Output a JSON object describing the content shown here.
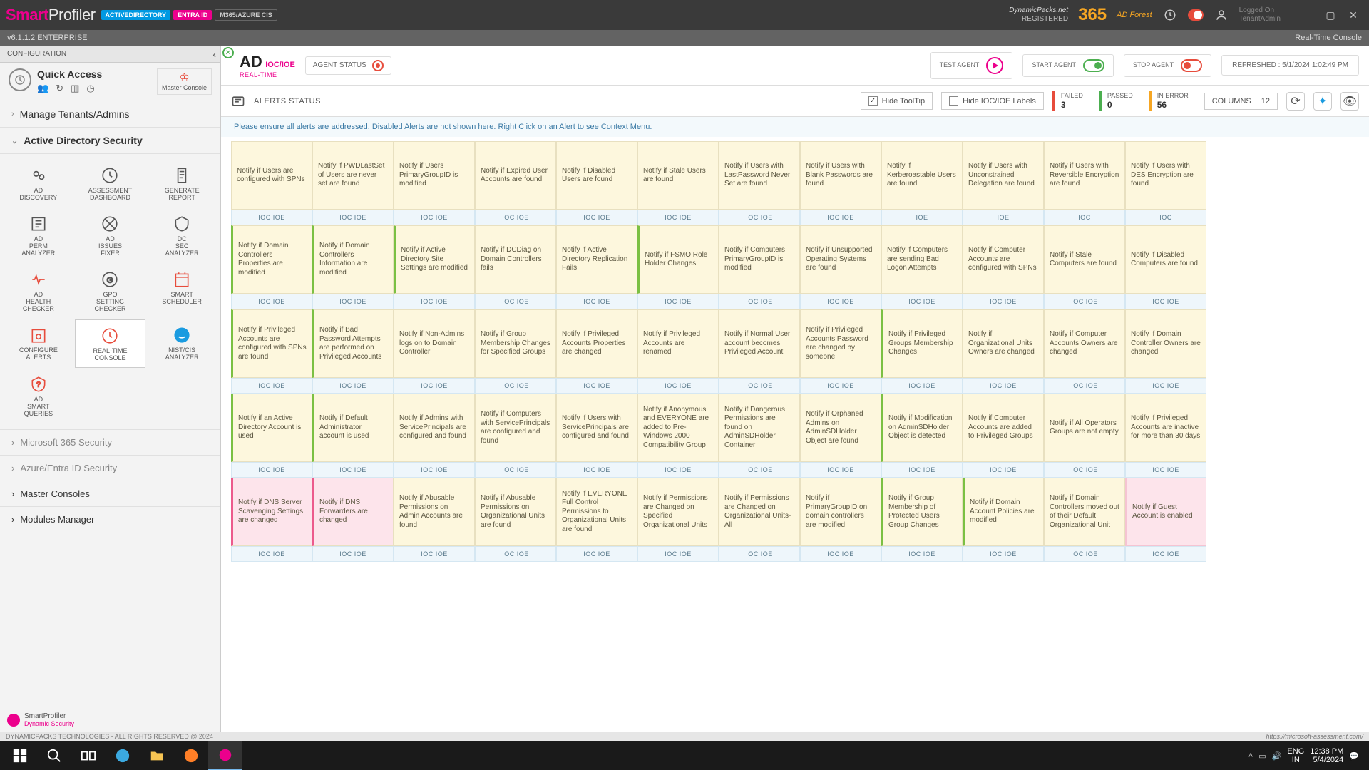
{
  "titlebar": {
    "logo_smart": "Smart",
    "logo_profiler": "Profiler",
    "badges": {
      "ad": "ACTIVEDIRECTORY",
      "entra": "ENTRA ID",
      "m365": "M365/AZURE CIS"
    },
    "reg_site": "DynamicPacks.net",
    "reg_status": "REGISTERED",
    "count365": "365",
    "adforest": "AD Forest",
    "logged_l1": "Logged On",
    "logged_l2": "TenantAdmin"
  },
  "verbar": {
    "left": "v6.1.1.2  ENTERPRISE",
    "right": "Real-Time Console"
  },
  "sidebar": {
    "config": "CONFIGURATION",
    "quick_access": "Quick Access",
    "master_console": "Master Console",
    "nav_tenants": "Manage Tenants/Admins",
    "nav_adsec": "Active Directory Security",
    "icons": [
      {
        "l": "AD DISCOVERY"
      },
      {
        "l": "ASSESSMENT DASHBOARD"
      },
      {
        "l": "GENERATE REPORT"
      },
      {
        "l": "AD PERM ANALYZER"
      },
      {
        "l": "AD ISSUES FIXER"
      },
      {
        "l": "DC SEC ANALYZER"
      },
      {
        "l": "AD HEALTH CHECKER"
      },
      {
        "l": "GPO SETTING CHECKER"
      },
      {
        "l": "SMART SCHEDULER"
      },
      {
        "l": "CONFIGURE ALERTS"
      },
      {
        "l": "REAL-TIME CONSOLE"
      },
      {
        "l": "NIST/CIS ANALYZER"
      },
      {
        "l": "AD SMART QUERIES"
      }
    ],
    "nav_m365": "Microsoft 365 Security",
    "nav_azure": "Azure/Entra ID Security",
    "nav_master": "Master Consoles",
    "nav_modules": "Modules Manager",
    "footer_l1": "SmartProfiler",
    "footer_l2": "Dynamic Security"
  },
  "header": {
    "ad": "AD",
    "ioc": "IOC/IOE",
    "rt": "REAL-TIME",
    "agent_status": "AGENT STATUS",
    "test": "TEST AGENT",
    "start": "START AGENT",
    "stop": "STOP AGENT",
    "refreshed": "REFRESHED : 5/1/2024 1:02:49 PM"
  },
  "alertsbar": {
    "title": "ALERTS STATUS",
    "hide_tooltip": "Hide ToolTip",
    "hide_labels": "Hide IOC/IOE Labels",
    "failed_l": "FAILED",
    "failed_v": "3",
    "passed_l": "PASSED",
    "passed_v": "0",
    "error_l": "IN ERROR",
    "error_v": "56",
    "columns_l": "COLUMNS",
    "columns_v": "12"
  },
  "note": "Please ensure all alerts are addressed. Disabled Alerts are not shown here. Right Click on an Alert to see Context Menu.",
  "tag_iocioe": "IOC IOE",
  "tag_ioe": "IOE",
  "tag_ioc": "IOC",
  "rows": [
    {
      "cards": [
        {
          "t": "Notify if Users are configured with SPNs"
        },
        {
          "t": "Notify if PWDLastSet of Users are never set are found"
        },
        {
          "t": "Notify if Users PrimaryGroupID is modified"
        },
        {
          "t": "Notify if Expired User Accounts are found"
        },
        {
          "t": "Notify if Disabled Users are found"
        },
        {
          "t": "Notify if Stale Users are found"
        },
        {
          "t": "Notify if Users with LastPassword Never Set are found"
        },
        {
          "t": "Notify if Users with Blank Passwords are found"
        },
        {
          "t": "Notify if Kerberoastable Users are found"
        },
        {
          "t": "Notify if Users with Unconstrained Delegation are found"
        },
        {
          "t": "Notify if Users with Reversible Encryption are found"
        },
        {
          "t": "Notify if Users with DES Encryption are found"
        }
      ],
      "tags": [
        "IOC IOE",
        "IOC IOE",
        "IOC IOE",
        "IOC IOE",
        "IOC IOE",
        "IOC IOE",
        "IOC IOE",
        "IOC IOE",
        "IOE",
        "IOE",
        "IOC",
        "IOC"
      ]
    },
    {
      "cards": [
        {
          "t": "Notify if Domain Controllers Properties are modified",
          "g": 1
        },
        {
          "t": "Notify if Domain Controllers Information are modified",
          "g": 1
        },
        {
          "t": "Notify if Active Directory Site Settings are modified",
          "g": 1
        },
        {
          "t": "Notify if DCDiag on Domain Controllers fails"
        },
        {
          "t": "Notify if Active Directory Replication Fails"
        },
        {
          "t": "Notify if FSMO Role Holder Changes",
          "g": 1
        },
        {
          "t": "Notify if Computers PrimaryGroupID is modified"
        },
        {
          "t": "Notify if Unsupported Operating Systems are found"
        },
        {
          "t": "Notify if Computers are sending Bad Logon Attempts"
        },
        {
          "t": "Notify if Computer Accounts are configured with SPNs"
        },
        {
          "t": "Notify if Stale Computers are found"
        },
        {
          "t": "Notify if Disabled Computers are found"
        }
      ],
      "tags": [
        "IOC IOE",
        "IOC IOE",
        "IOC IOE",
        "IOC IOE",
        "IOC IOE",
        "IOC IOE",
        "IOC IOE",
        "IOC IOE",
        "IOC IOE",
        "IOC IOE",
        "IOC IOE",
        "IOC IOE"
      ]
    },
    {
      "cards": [
        {
          "t": "Notify if Privileged Accounts are configured with SPNs are found",
          "g": 1
        },
        {
          "t": "Notify if Bad Password Attempts are performed on Privileged Accounts",
          "g": 1
        },
        {
          "t": "Notify if Non-Admins logs on to Domain Controller"
        },
        {
          "t": "Notify if Group Membership Changes for Specified Groups"
        },
        {
          "t": "Notify if Privileged Accounts Properties are changed"
        },
        {
          "t": "Notify if Privileged Accounts are renamed"
        },
        {
          "t": "Notify if Normal User account becomes Privileged Account"
        },
        {
          "t": "Notify if Privileged Accounts Password are changed by someone"
        },
        {
          "t": "Notify if Privileged Groups Membership Changes",
          "g": 1
        },
        {
          "t": "Notify if Organizational Units Owners are changed"
        },
        {
          "t": "Notify if Computer Accounts Owners are changed"
        },
        {
          "t": "Notify if Domain Controller Owners are changed"
        }
      ],
      "tags": [
        "IOC IOE",
        "IOC IOE",
        "IOC IOE",
        "IOC IOE",
        "IOC IOE",
        "IOC IOE",
        "IOC IOE",
        "IOC IOE",
        "IOC IOE",
        "IOC IOE",
        "IOC IOE",
        "IOC IOE"
      ]
    },
    {
      "cards": [
        {
          "t": "Notify if an Active Directory Account is used",
          "g": 1
        },
        {
          "t": "Notify if Default Administrator account is used",
          "g": 1
        },
        {
          "t": "Notify if Admins with ServicePrincipals are configured and found"
        },
        {
          "t": "Notify if Computers with ServicePrincipals are configured and found"
        },
        {
          "t": "Notify if Users with ServicePrincipals are configured and found"
        },
        {
          "t": "Notify if Anonymous and EVERYONE are added to Pre-Windows 2000 Compatibility Group"
        },
        {
          "t": "Notify if Dangerous Permissions are found on AdminSDHolder Container"
        },
        {
          "t": "Notify if Orphaned Admins on AdminSDHolder Object are found"
        },
        {
          "t": "Notify if Modification on AdminSDHolder Object is detected",
          "g": 1
        },
        {
          "t": "Notify if Computer Accounts are added to Privileged Groups"
        },
        {
          "t": "Notify if All Operators Groups are not empty"
        },
        {
          "t": "Notify if Privileged Accounts are inactive for more than 30 days"
        }
      ],
      "tags": [
        "IOC IOE",
        "IOC IOE",
        "IOC IOE",
        "IOC IOE",
        "IOC IOE",
        "IOC IOE",
        "IOC IOE",
        "IOC IOE",
        "IOC IOE",
        "IOC IOE",
        "IOC IOE",
        "IOC IOE"
      ]
    },
    {
      "cards": [
        {
          "t": "Notify if DNS Server Scavenging Settings are changed",
          "p": 1
        },
        {
          "t": "Notify if DNS Forwarders are changed",
          "p": 1
        },
        {
          "t": "Notify if Abusable Permissions on Admin Accounts are found"
        },
        {
          "t": "Notify if Abusable Permissions on Organizational Units are found"
        },
        {
          "t": "Notify if EVERYONE Full Control Permissions to Organizational Units are found"
        },
        {
          "t": "Notify if Permissions are Changed on Specified Organizational Units"
        },
        {
          "t": "Notify if Permissions are Changed on Organizational Units-All"
        },
        {
          "t": "Notify if PrimaryGroupID on domain controllers are modified"
        },
        {
          "t": "Notify if Group Membership of Protected Users Group Changes",
          "g": 1
        },
        {
          "t": "Notify if Domain Account Policies are modified",
          "g": 1
        },
        {
          "t": "Notify if Domain Controllers moved out of their Default Organizational Unit"
        },
        {
          "t": "Notify if Guest Account is enabled",
          "p": 1,
          "pb": 1
        }
      ],
      "tags": [
        "IOC IOE",
        "IOC IOE",
        "IOC IOE",
        "IOC IOE",
        "IOC IOE",
        "IOC IOE",
        "IOC IOE",
        "IOC IOE",
        "IOC IOE",
        "IOC IOE",
        "IOC IOE",
        "IOC IOE"
      ]
    }
  ],
  "footer": {
    "left": "DYNAMICPACKS TECHNOLOGIES - ALL RIGHTS RESERVED @ 2024",
    "right": "https://microsoft-assessment.com/"
  },
  "taskbar": {
    "lang1": "ENG",
    "lang2": "IN",
    "time": "12:38 PM",
    "date": "5/4/2024"
  }
}
